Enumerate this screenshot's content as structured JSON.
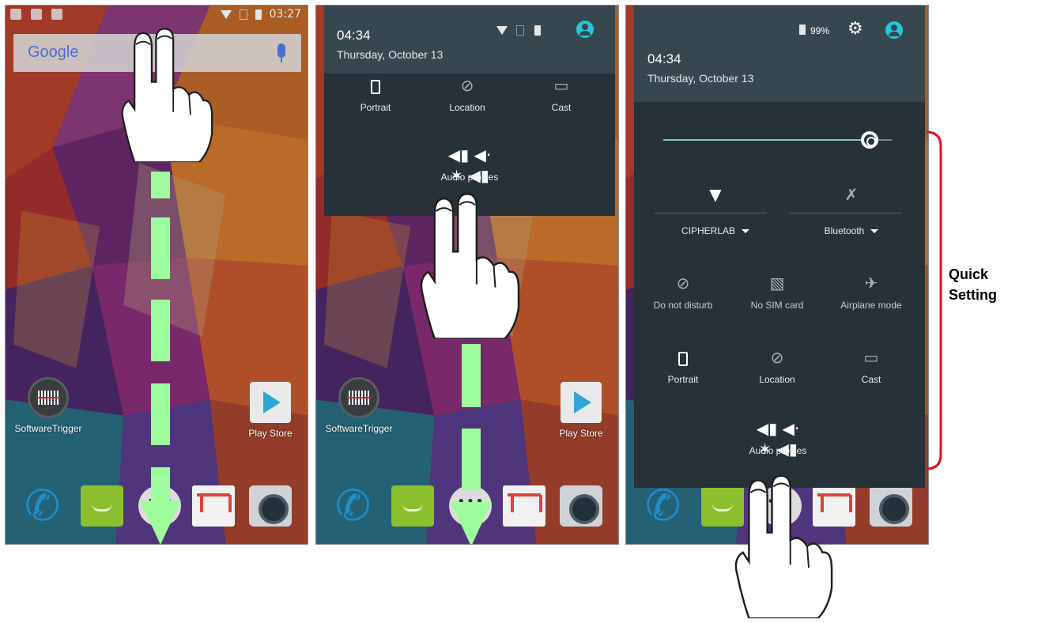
{
  "status_bar": {
    "time": "03:27"
  },
  "google_bar": {
    "logo": "Google",
    "mic_icon": "mic-icon"
  },
  "home_apps": [
    {
      "label": "SoftwareTrigger"
    },
    {
      "label": "Play Store"
    }
  ],
  "dock_icons": [
    "phone-icon",
    "messaging-icon",
    "app-drawer-icon",
    "gmail-icon",
    "camera-icon"
  ],
  "shade_partial": {
    "time": "04:34",
    "date": "Thursday, October 13",
    "tiles": [
      {
        "label": "Portrait",
        "icon": "portrait-icon"
      },
      {
        "label": "Location",
        "icon": "location-off-icon"
      },
      {
        "label": "Cast",
        "icon": "cast-icon"
      }
    ],
    "audio_profiles": "Audio profiles"
  },
  "shade_full": {
    "battery": "99%",
    "time": "04:34",
    "date": "Thursday, October 13",
    "brightness_level": 0.89,
    "wifi": {
      "label": "CIPHERLAB",
      "icon": "wifi-icon"
    },
    "bluetooth": {
      "label": "Bluetooth",
      "icon": "bluetooth-off-icon"
    },
    "tiles_row1": [
      {
        "label": "Do not disturb",
        "icon": "do-not-disturb-icon"
      },
      {
        "label": "No SIM card",
        "icon": "no-sim-icon"
      },
      {
        "label": "Airplane mode",
        "icon": "airplane-icon"
      }
    ],
    "tiles_row2": [
      {
        "label": "Portrait",
        "icon": "portrait-icon"
      },
      {
        "label": "Location",
        "icon": "location-off-icon"
      },
      {
        "label": "Cast",
        "icon": "cast-icon"
      }
    ],
    "audio_profiles": "Audio profiles"
  },
  "annotation": {
    "line1": "Quick",
    "line2": "Setting",
    "color": "#e1111b"
  },
  "colors": {
    "arrow": "#9dfc9b",
    "shade_bg": "#263238",
    "shade_header": "#37474f",
    "accent": "#26c6da"
  }
}
